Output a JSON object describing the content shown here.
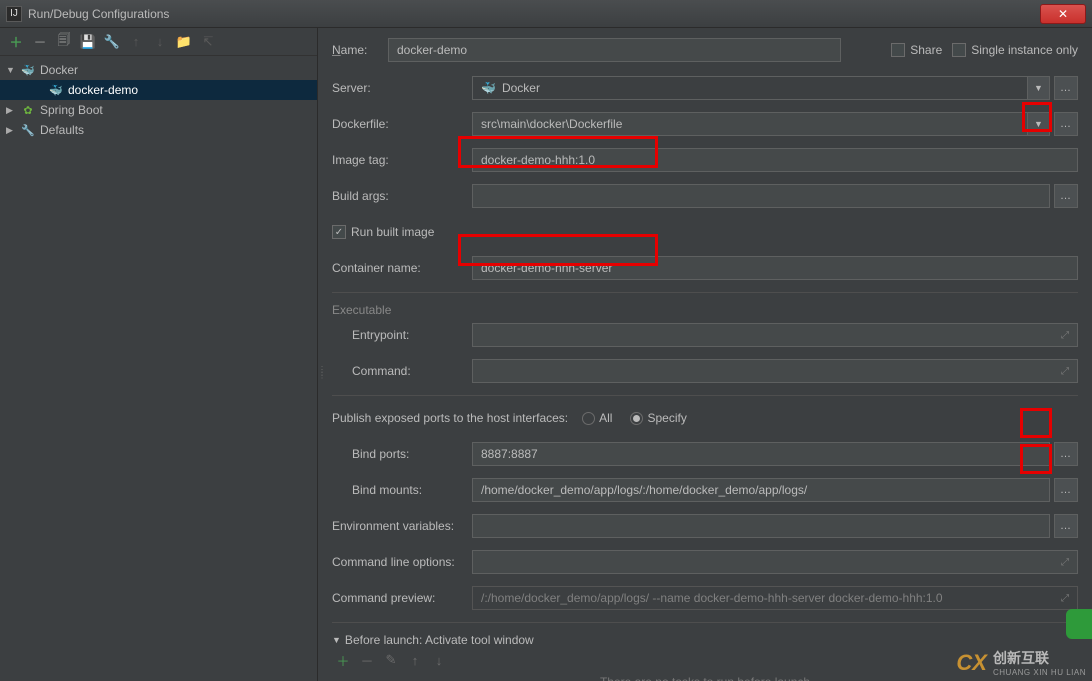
{
  "window": {
    "title": "Run/Debug Configurations"
  },
  "tree": {
    "docker": "Docker",
    "docker_demo": "docker-demo",
    "spring_boot": "Spring Boot",
    "defaults": "Defaults"
  },
  "form": {
    "name_label": "Name:",
    "name_value": "docker-demo",
    "share_label": "Share",
    "single_label": "Single instance only",
    "server_label": "Server:",
    "server_value": "Docker",
    "dockerfile_label": "Dockerfile:",
    "dockerfile_value": "src\\main\\docker\\Dockerfile",
    "image_tag_label": "Image tag:",
    "image_tag_value": "docker-demo-hhh:1.0",
    "build_args_label": "Build args:",
    "build_args_value": "",
    "run_built_label": "Run built image",
    "container_name_label": "Container name:",
    "container_name_value": "docker-demo-hhh-server",
    "executable_title": "Executable",
    "entrypoint_label": "Entrypoint:",
    "command_label": "Command:",
    "publish_label": "Publish exposed ports to the host interfaces:",
    "radio_all": "All",
    "radio_specify": "Specify",
    "bind_ports_label": "Bind ports:",
    "bind_ports_value": "8887:8887",
    "bind_mounts_label": "Bind mounts:",
    "bind_mounts_value": "/home/docker_demo/app/logs/:/home/docker_demo/app/logs/",
    "env_vars_label": "Environment variables:",
    "cmd_options_label": "Command line options:",
    "cmd_preview_label": "Command preview:",
    "cmd_preview_value": "/:/home/docker_demo/app/logs/ --name docker-demo-hhh-server docker-demo-hhh:1.0"
  },
  "before_launch": {
    "header": "Before launch: Activate tool window",
    "empty": "There are no tasks to run before launch"
  },
  "watermark": {
    "brand": "创新互联",
    "sub": "CHUANG XIN HU LIAN"
  }
}
